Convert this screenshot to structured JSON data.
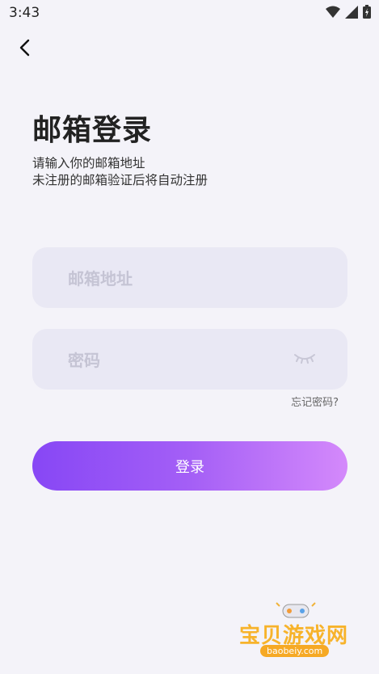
{
  "status_bar": {
    "time": "3:43",
    "icons": [
      "wifi-icon",
      "signal-icon",
      "battery-icon"
    ]
  },
  "header": {
    "back_icon": "chevron-left-icon",
    "title": "邮箱登录",
    "subtitle_line1": "请输入你的邮箱地址",
    "subtitle_line2": "未注册的邮箱验证后将自动注册"
  },
  "form": {
    "email": {
      "value": "",
      "placeholder": "邮箱地址"
    },
    "password": {
      "value": "",
      "placeholder": "密码",
      "toggle_icon": "eye-closed-icon"
    },
    "forgot_password": "忘记密码?",
    "submit_label": "登录"
  },
  "watermark": {
    "text": "宝贝游戏网",
    "url": "baobeiy.com"
  },
  "colors": {
    "background": "#f4f3f9",
    "field_bg": "#e9e8f4",
    "button_gradient_start": "#8747f5",
    "button_gradient_end": "#d489fb"
  }
}
